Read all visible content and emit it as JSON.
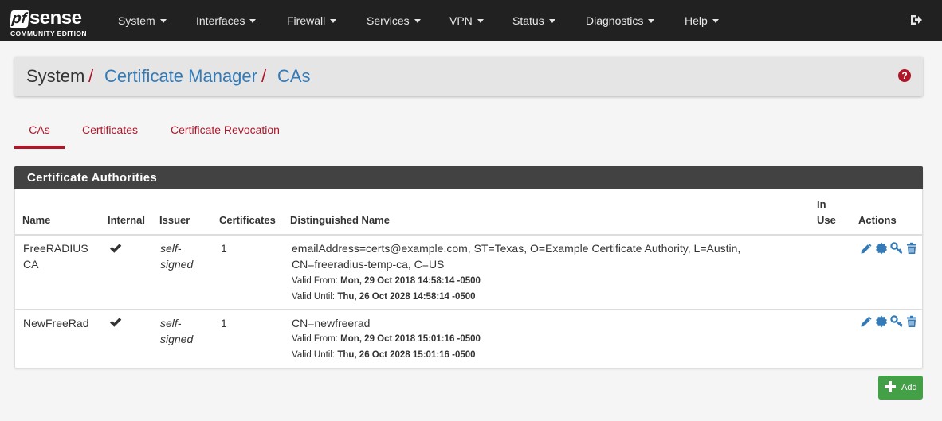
{
  "nav": {
    "logo_pf": "pf",
    "logo_sense": "sense",
    "logo_sub": "COMMUNITY EDITION",
    "items": [
      {
        "label": "System"
      },
      {
        "label": "Interfaces"
      },
      {
        "label": "Firewall"
      },
      {
        "label": "Services"
      },
      {
        "label": "VPN"
      },
      {
        "label": "Status"
      },
      {
        "label": "Diagnostics"
      },
      {
        "label": "Help"
      }
    ],
    "logout_icon": "sign-out-icon"
  },
  "breadcrumb": {
    "items": [
      "System",
      "Certificate Manager",
      "CAs"
    ],
    "separator": "/",
    "help_label": "?"
  },
  "tabs": [
    {
      "label": "CAs",
      "active": true
    },
    {
      "label": "Certificates",
      "active": false
    },
    {
      "label": "Certificate Revocation",
      "active": false
    }
  ],
  "panel": {
    "title": "Certificate Authorities",
    "columns": {
      "name": "Name",
      "internal": "Internal",
      "issuer": "Issuer",
      "certificates": "Certificates",
      "dn": "Distinguished Name",
      "in_use_1": "In",
      "in_use_2": "Use",
      "actions": "Actions"
    },
    "valid_from_label": "Valid From:",
    "valid_until_label": "Valid Until:",
    "rows": [
      {
        "name_1": "FreeRADIUS",
        "name_2": "CA",
        "internal": true,
        "issuer_1": "self-",
        "issuer_2": "signed",
        "certificates": "1",
        "dn_1": "emailAddress=certs@example.com, ST=Texas, O=Example Certificate Authority, L=Austin,",
        "dn_2": "CN=freeradius-temp-ca, C=US",
        "valid_from": "Mon, 29 Oct 2018 14:58:14 -0500",
        "valid_until": "Thu, 26 Oct 2028 14:58:14 -0500"
      },
      {
        "name_1": "NewFreeRad",
        "name_2": "",
        "internal": true,
        "issuer_1": "self-",
        "issuer_2": "signed",
        "certificates": "1",
        "dn_1": "CN=newfreerad",
        "dn_2": "",
        "valid_from": "Mon, 29 Oct 2018 15:01:16 -0500",
        "valid_until": "Thu, 26 Oct 2028 15:01:16 -0500"
      }
    ],
    "action_icons": [
      "pencil-icon",
      "certificate-icon",
      "key-icon",
      "trash-icon"
    ]
  },
  "add_button": {
    "label": "Add",
    "icon": "plus-icon"
  },
  "colors": {
    "navbar": "#212121",
    "brand_red": "#b0162a",
    "link_blue": "#337ab7",
    "panel_heading": "#424242",
    "add_green": "#43a047"
  }
}
